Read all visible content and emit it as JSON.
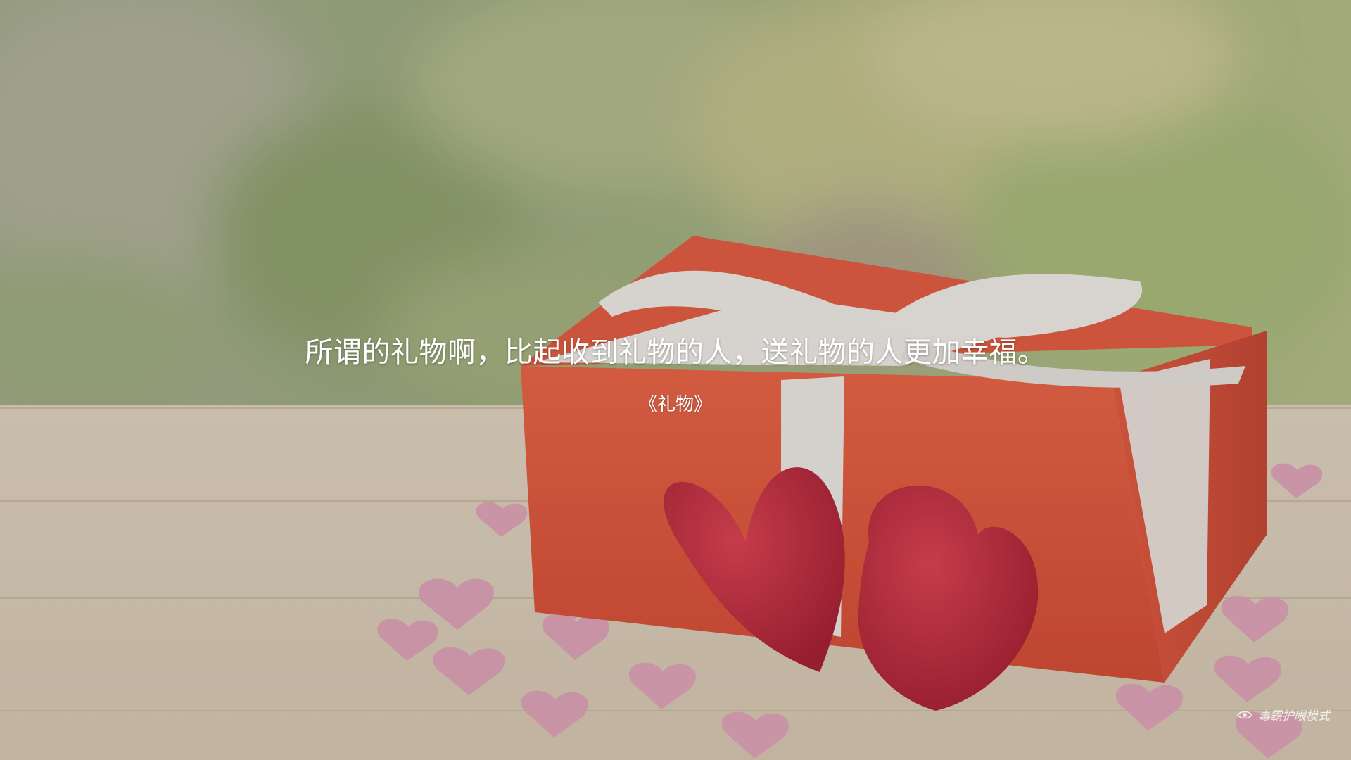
{
  "screen": {
    "quote": "所谓的礼物啊，比起收到礼物的人，送礼物的人更加幸福。",
    "source": "《礼物》"
  },
  "badge": {
    "label": "毒霸护眼模式",
    "icon": "eye-icon"
  },
  "colors": {
    "text": "#ffffff",
    "gift_box": "#e0452f",
    "ribbon": "#f3f0ec",
    "heart_red": "#c91f32",
    "heart_pink": "#e9a0b8",
    "table": "#e2d3bd"
  }
}
